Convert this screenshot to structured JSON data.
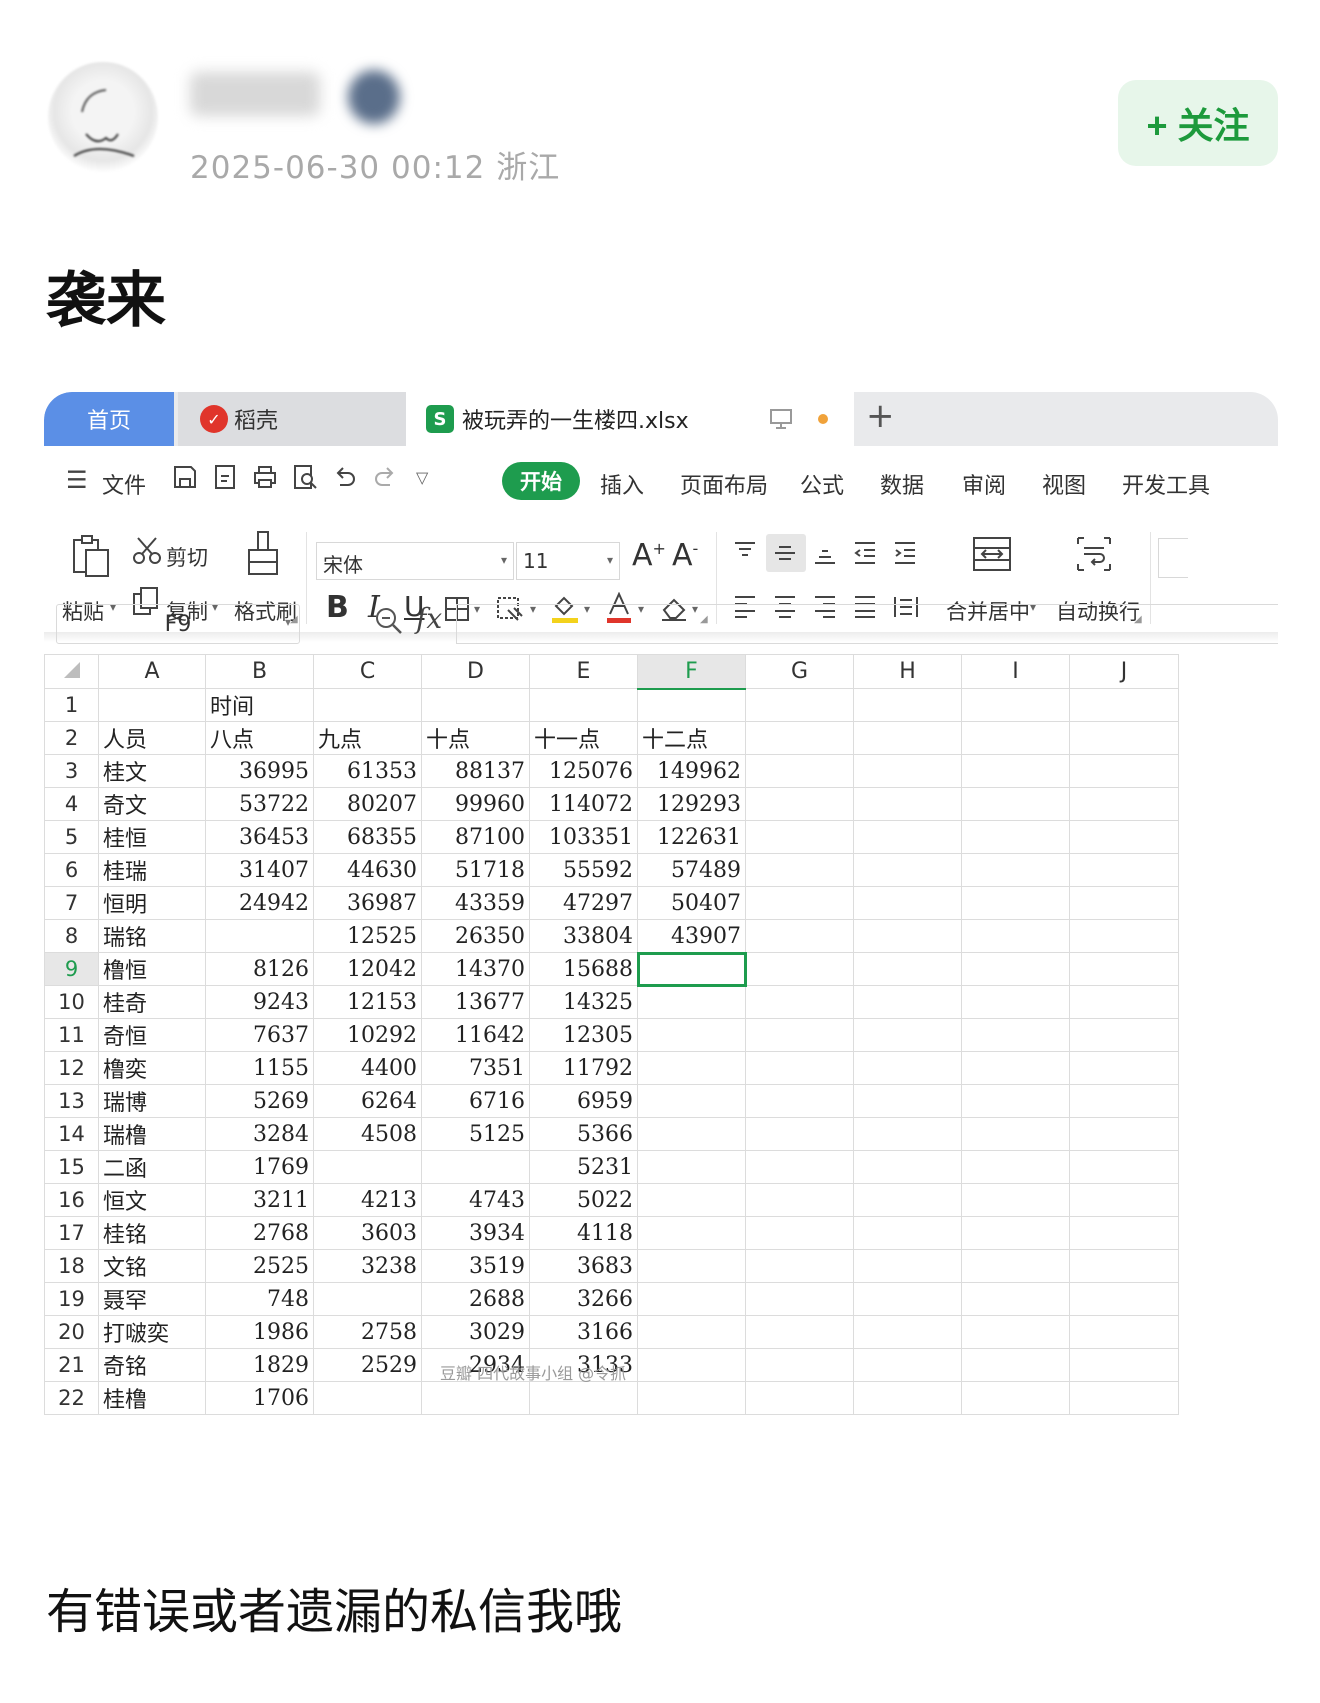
{
  "post": {
    "timestamp": "2025-06-30 00:12",
    "location": "浙江",
    "follow_label": "+ 关注",
    "title": "袭来",
    "footer_text": "有错误或者遗漏的私信我哦"
  },
  "app": {
    "tabs": {
      "home": "首页",
      "daoke": "稻壳",
      "file": "被玩弄的一生楼四.xlsx"
    },
    "menu": {
      "file": "文件",
      "start": "开始",
      "insert": "插入",
      "page_layout": "页面布局",
      "formula": "公式",
      "data": "数据",
      "review": "审阅",
      "view": "视图",
      "developer": "开发工具"
    },
    "ribbon": {
      "paste": "粘贴",
      "cut": "剪切",
      "copy": "复制",
      "format_painter": "格式刷",
      "font_name": "宋体",
      "font_size": "11",
      "merge_center": "合并居中",
      "wrap_text": "自动换行"
    },
    "accent_color": "#1e9c4e",
    "home_tab_color": "#5b8fe6"
  },
  "formula_bar": {
    "cell_ref": "F9",
    "fx_label": "fx",
    "value": ""
  },
  "sheet": {
    "columns": [
      "A",
      "B",
      "C",
      "D",
      "E",
      "F",
      "G",
      "H",
      "I",
      "J"
    ],
    "selected_cell": "F9",
    "rows": [
      {
        "n": "1",
        "cells": [
          "",
          "时间",
          "",
          "",
          "",
          ""
        ]
      },
      {
        "n": "2",
        "cells": [
          "人员",
          "八点",
          "九点",
          "十点",
          "十一点",
          "十二点"
        ]
      },
      {
        "n": "3",
        "cells": [
          "桂文",
          "36995",
          "61353",
          "88137",
          "125076",
          "149962"
        ]
      },
      {
        "n": "4",
        "cells": [
          "奇文",
          "53722",
          "80207",
          "99960",
          "114072",
          "129293"
        ]
      },
      {
        "n": "5",
        "cells": [
          "桂恒",
          "36453",
          "68355",
          "87100",
          "103351",
          "122631"
        ]
      },
      {
        "n": "6",
        "cells": [
          "桂瑞",
          "31407",
          "44630",
          "51718",
          "55592",
          "57489"
        ]
      },
      {
        "n": "7",
        "cells": [
          "恒明",
          "24942",
          "36987",
          "43359",
          "47297",
          "50407"
        ]
      },
      {
        "n": "8",
        "cells": [
          "瑞铭",
          "",
          "12525",
          "26350",
          "33804",
          "43907"
        ]
      },
      {
        "n": "9",
        "cells": [
          "橹恒",
          "8126",
          "12042",
          "14370",
          "15688",
          ""
        ]
      },
      {
        "n": "10",
        "cells": [
          "桂奇",
          "9243",
          "12153",
          "13677",
          "14325",
          ""
        ]
      },
      {
        "n": "11",
        "cells": [
          "奇恒",
          "7637",
          "10292",
          "11642",
          "12305",
          ""
        ]
      },
      {
        "n": "12",
        "cells": [
          "橹奕",
          "1155",
          "4400",
          "7351",
          "11792",
          ""
        ]
      },
      {
        "n": "13",
        "cells": [
          "瑞博",
          "5269",
          "6264",
          "6716",
          "6959",
          ""
        ]
      },
      {
        "n": "14",
        "cells": [
          "瑞橹",
          "3284",
          "4508",
          "5125",
          "5366",
          ""
        ]
      },
      {
        "n": "15",
        "cells": [
          "二函",
          "1769",
          "",
          "",
          "5231",
          ""
        ]
      },
      {
        "n": "16",
        "cells": [
          "恒文",
          "3211",
          "4213",
          "4743",
          "5022",
          ""
        ]
      },
      {
        "n": "17",
        "cells": [
          "桂铭",
          "2768",
          "3603",
          "3934",
          "4118",
          ""
        ]
      },
      {
        "n": "18",
        "cells": [
          "文铭",
          "2525",
          "3238",
          "3519",
          "3683",
          ""
        ]
      },
      {
        "n": "19",
        "cells": [
          "聂罕",
          "748",
          "",
          "2688",
          "3266",
          ""
        ]
      },
      {
        "n": "20",
        "cells": [
          "打啵奕",
          "1986",
          "2758",
          "3029",
          "3166",
          ""
        ]
      },
      {
        "n": "21",
        "cells": [
          "奇铭",
          "1829",
          "2529",
          "2934",
          "3133",
          ""
        ]
      },
      {
        "n": "22",
        "cells": [
          "桂橹",
          "1706",
          "",
          "",
          "",
          ""
        ]
      }
    ]
  },
  "watermark": "豆瓣 四代故事小组 @令抓"
}
